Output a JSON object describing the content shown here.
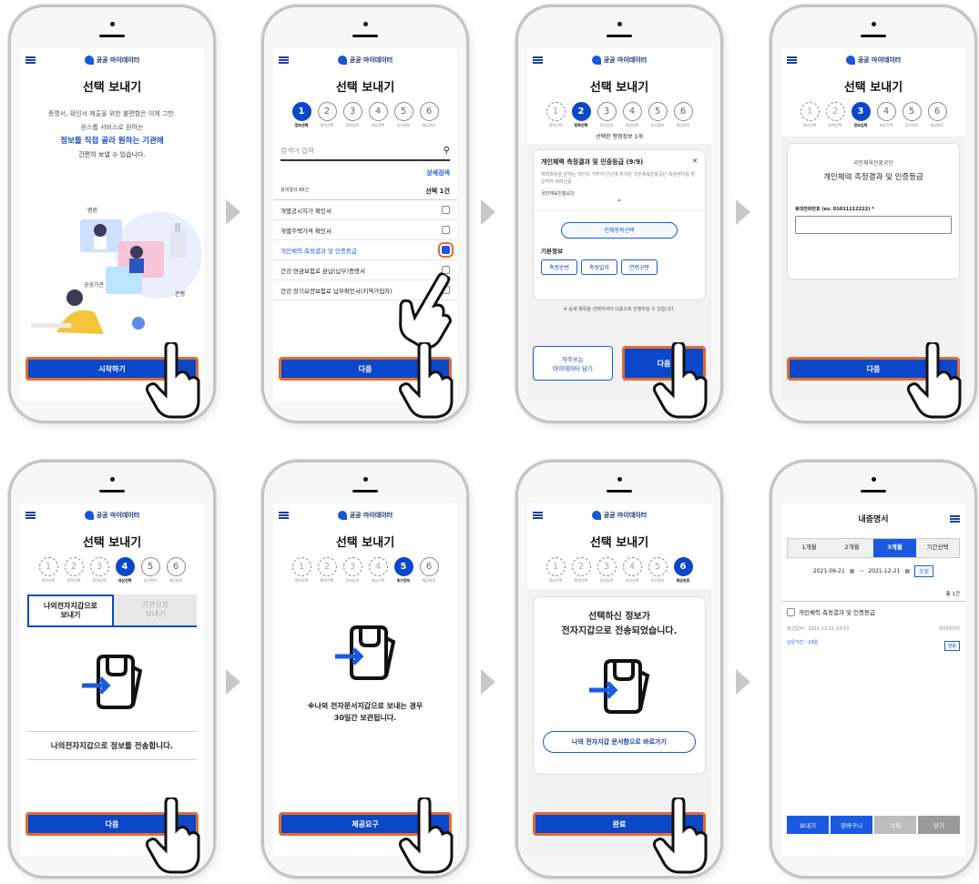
{
  "brand": "공공 마이데이터",
  "title": "선택 보내기",
  "steps": [
    "정보선택",
    "항목선택",
    "정보입력",
    "대상선택",
    "추가정보",
    "제공완료"
  ],
  "s1": {
    "line1": "증명서, 확인서 제출을 위한 불편함은 이제 그만.",
    "line2": "원스톱 서비스로 원하는",
    "line3": "정보를 직접 골라 원하는 기관에",
    "line4": "간편히 보낼 수 있습니다.",
    "btn": "시작하기",
    "ill_labels": [
      "병원",
      "공공기관",
      "은행"
    ]
  },
  "s2": {
    "search_ph": "검색어 입력",
    "adv": "상세검색",
    "count_l": "검색결과 88건",
    "count_r": "선택 1건",
    "items": [
      "개별공시지가 확인서",
      "개별주택가격 확인서",
      "개인체력 측정결과 및 인증등급",
      "건강·연금보험료 완납(납부)증명서",
      "건강·장기요양보험료 납부확인서(지역가입자)"
    ],
    "btn": "다음"
  },
  "s3": {
    "selected": "선택한 행정정보 1개",
    "card_title": "개인체력 측정결과 및 인증등급 (9/9)",
    "card_desc": "체력측정을 원하는 개인이 거주지 인근에 위치한 국민체육진흥공단 측정센터를 방문하여 체력인증",
    "agency": "국민체육진흥공단",
    "all": "전체항목선택",
    "basic": "기본정보",
    "tags": [
      "측정순번",
      "측정일자",
      "연령구분"
    ],
    "note": "※ 상세 항목을 선택하셔야 다음으로 진행하실 수 있습니다.",
    "fav_btn": "자주쓰는\n마이데이터 담기",
    "btn": "다음"
  },
  "s4": {
    "agency": "국민체육진흥공단",
    "name": "개인체력 측정결과 및 인증등급",
    "phone_label": "휴대전화번호 (ex. 01011112222) *",
    "phone_val": "",
    "btn": "다음"
  },
  "s5": {
    "tab1": "나의전자지갑으로\n보내기",
    "tab2": "기관으로\n보내기",
    "msg": "나의전자지갑으로 정보를 전송합니다.",
    "btn": "다음"
  },
  "s6": {
    "msg1": "※나의 전자문서지갑으로 보내는 경우",
    "msg2": "30일간 보관됩니다.",
    "btn": "제공요구"
  },
  "s7": {
    "msg1": "선택하신 정보가",
    "msg2": "전자지갑으로 전송되었습니다.",
    "link": "나의 전자지갑 문서함으로 바로가기",
    "btn": "완료"
  },
  "s8": {
    "title": "내증명서",
    "periods": [
      "1개월",
      "2개월",
      "3개월",
      "기간선택"
    ],
    "from": "2021-09-21",
    "to": "2021-12-21",
    "search": "조회",
    "total": "총 1건",
    "item_name": "개인체력 측정결과 및 인증등급",
    "issued": "발급일자 : 2021-12-21 14:53",
    "remain": "남은기간 : 29일",
    "source": "마이데이터",
    "badge": "열람",
    "btns": [
      "보내기",
      "장바구니",
      "삭제",
      "닫기"
    ]
  },
  "colors": {
    "primary": "#0b47c9",
    "highlight": "#e26b2d",
    "link": "#1a5ae0"
  }
}
